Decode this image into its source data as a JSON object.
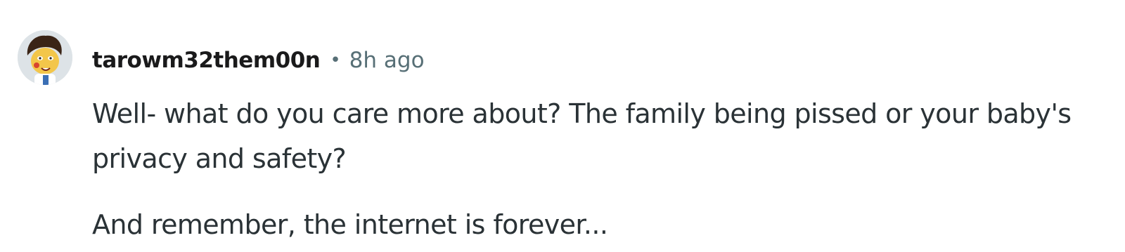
{
  "comment": {
    "avatar_icon": "user-avatar-icon",
    "username": "tarowm32them00n",
    "separator": "•",
    "timestamp": "8h ago",
    "paragraphs": [
      "Well- what do you care more about? The family being pissed or your baby's privacy and safety?",
      "And remember, the internet is forever..."
    ]
  }
}
